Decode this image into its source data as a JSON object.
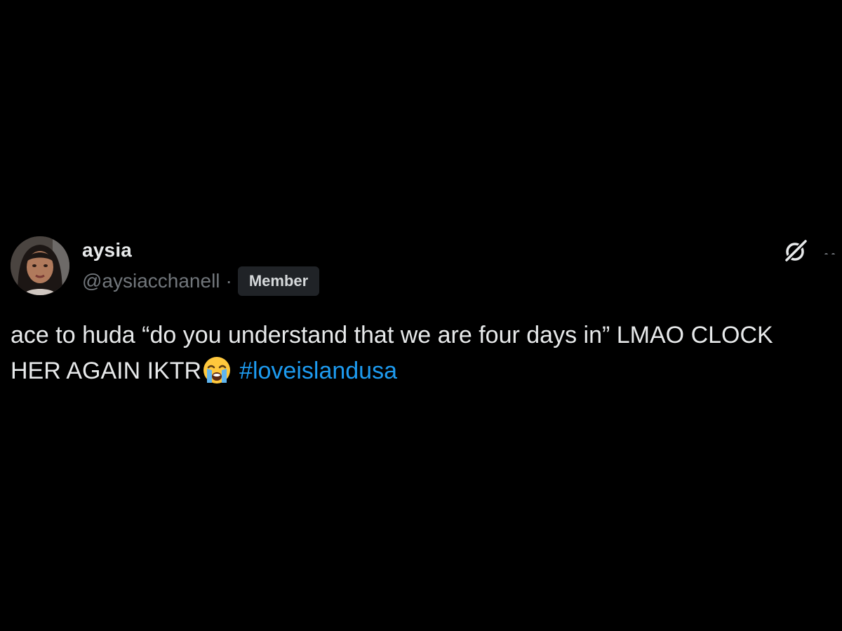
{
  "post": {
    "author": {
      "display_name": "aysia",
      "handle": "@aysiacchanell",
      "separator": "·",
      "badge": "Member",
      "avatar": "profile-photo"
    },
    "text": {
      "line1": "ace to huda “do you understand that we are four days in” LMAO CLOCK",
      "line2": "HER AGAIN IKTR",
      "emoji": "loudly-crying-face",
      "hashtag": "#loveislandusa"
    },
    "icons": {
      "grok": "grok-icon",
      "more": "more-icon"
    }
  },
  "colors": {
    "background": "#000000",
    "text": "#e7e9ea",
    "secondary": "#71767b",
    "link": "#1d9bf0",
    "badge_bg": "#202327"
  }
}
